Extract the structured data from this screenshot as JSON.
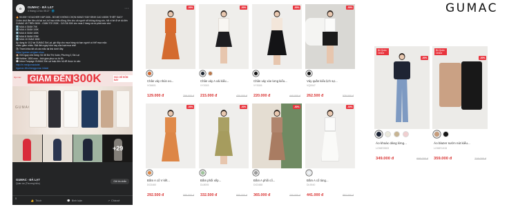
{
  "facebook": {
    "page_name": "GUMAC - ĐÀ LẠT",
    "post_meta": "4 tháng 12 lúc 05:27 · 🌐",
    "headline": "🔥 90.000+ VOUCHER HẤP DẪN - BỐ MẸ KHÔNG CHỌN HÀNG? ĐÂY ĐỈNH CAO #300K THIỆT SAO?",
    "lines": [
      "Chăm chút lắm tiền chi tại nơi, bỏ bao nhiêu đồng, tiền cho cả người sẽ không dùng còn, hỏi vì bé đi về dù liên",
      "GUMAC 49 TRÊN 300K - GIẢM TỚI 200K - CẢ GIẢ 50K cho mua 2 hàng và nó phát món chờ",
      "1️⃣ MUA 4 GIẢM 70K",
      "2️⃣ MUA 4 GIẢM 100K",
      "3️⃣ MUA 6 GIẢM 180K",
      "4️⃣ MUA 8 GIẢM 225K",
      "5️⃣ MUA 10 GIẢM 300K",
      "Áp dụng từ 1/12 tại GUMAC Đà Lạt, giờ đây cho mua hàng và bạn người có thể mua mặc",
      "nhiều giảm nhiều. Đặt đến ngày hôm nay của loạt mua nhé!",
      "🛍 Tham khảo tất cả các mẫu tại link dưới đây:",
      "https://gumac.vn/giam-nhau",
      "🏠 Gửi ngay cửa hàng: Số 48 Bùi Thị Xuân, Phường 2, Đà Lạt",
      "☎ Hotline: 1800.xxxx - thời gian phục vụ từ 8h",
      "💬 Inbox Fanpage GUMAC Đà Lạt hoặc liên hệ để được tư vấn:",
      "http://m.me/gumacdalat",
      "#gumac #thoitranggumac #dalat"
    ],
    "banner": {
      "ribbon": "#gumac",
      "headline": "GIẢM ĐẾN",
      "amount": "300K",
      "tag": "GIÁ CHỈ HÔM NAY",
      "logo": "GUMAC"
    },
    "more_photos": "+29",
    "footer_page": "GUMAC - ĐÀ LẠT",
    "footer_sub": "Quần áo (Thương hiệu)",
    "message_btn": "Gửi tin nhắn",
    "like_count": "5",
    "actions": [
      "Thích",
      "Bình luận",
      "Chia sẻ"
    ]
  },
  "brand": "GUMAC",
  "products_row1": [
    {
      "name": "Chân váy nhún eo...",
      "code": "VG6601",
      "price": "129.000 đ",
      "old": "259.000 đ",
      "discount": "-50%"
    },
    {
      "name": "Chân váy A vải kiểu...",
      "code": "VY2003",
      "price": "215.000 đ",
      "old": "430.000 đ",
      "discount": "-50%"
    },
    {
      "name": "Chân váy xòe lưng kiểu...",
      "code": "VY3026",
      "price": "220.000 đ",
      "old": "440.000 đ",
      "discount": "-50%"
    },
    {
      "name": "Váy quần kiểu lịch sự...",
      "code": "VQ0047",
      "price": "262.500 đ",
      "old": "525.000 đ",
      "discount": "-50%"
    }
  ],
  "products_row2": [
    {
      "name": "Đầm A cổ V kết...",
      "code": "DG3460",
      "price": "292.500 đ",
      "old": "585.000 đ",
      "discount": "-50%"
    },
    {
      "name": "Đầm phối xếp...",
      "code": "DL8005",
      "price": "332.500 đ",
      "old": "665.000 đ",
      "discount": "-50%"
    },
    {
      "name": "Đầm A phối cổ...",
      "code": "DG3488",
      "price": "365.000 đ",
      "old": "730.000 đ",
      "discount": "-50%"
    },
    {
      "name": "Đầm A cổ tùng...",
      "code": "DL9040",
      "price": "441.000 đ",
      "old": "882.000 đ",
      "discount": "-50%"
    }
  ],
  "products_right": [
    {
      "name": "Áo khoác dáng lửng...",
      "code": "LOWE0503",
      "price": "349.000 đ",
      "old": "698.000 đ",
      "discount": "-50%",
      "ribbon": "Bộ Quần Online"
    },
    {
      "name": "Áo blazer sườn nút kiểu...",
      "code": "LOWE1015",
      "price": "359.000 đ",
      "old": "718.000 đ",
      "discount": "-50%",
      "ribbon": "Bộ Quần Online"
    }
  ]
}
